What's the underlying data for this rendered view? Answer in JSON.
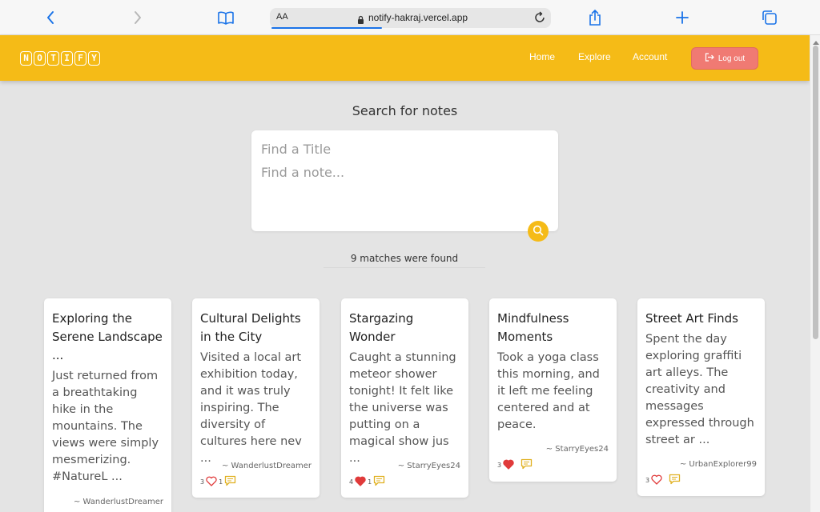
{
  "browser": {
    "text_size_label": "AA",
    "url": "notify-hakraj.vercel.app"
  },
  "header": {
    "logo_letters": [
      "N",
      "O",
      "T",
      "I",
      "F",
      "Y"
    ],
    "nav": {
      "home": "Home",
      "explore": "Explore",
      "account": "Account"
    },
    "logout_label": "Log out",
    "brand_color": "#f5bb17",
    "logout_color": "#f07a73"
  },
  "search": {
    "heading": "Search for notes",
    "title_placeholder": "Find a Title",
    "note_placeholder": "Find a note...",
    "results_text": "9 matches were found"
  },
  "notes": [
    {
      "title": "Exploring the Serene Landscape ...",
      "body": "Just returned from a breathtaking hike in the mountains. The views were simply mesmerizing. #NatureL ...",
      "author": "~ WanderlustDreamer",
      "likes": "",
      "comments": "",
      "liked": false
    },
    {
      "title": "Cultural Delights in the City",
      "body": "Visited a local art exhibition today, and it was truly inspiring. The diversity of cultures here nev ...",
      "author": "~ WanderlustDreamer",
      "likes": "3",
      "comments": "1",
      "liked": false
    },
    {
      "title": "Stargazing Wonder",
      "body": "Caught a stunning meteor shower tonight! It felt like the universe was putting on a magical show jus ...",
      "author": "~ StarryEyes24",
      "likes": "4",
      "comments": "1",
      "liked": true
    },
    {
      "title": "Mindfulness Moments",
      "body": "Took a yoga class this morning, and it left me feeling centered and at peace.",
      "author": "~ StarryEyes24",
      "likes": "3",
      "comments": "",
      "liked": true
    },
    {
      "title": "Street Art Finds",
      "body": "Spent the day exploring graffiti art alleys. The creativity and messages expressed through street ar ...",
      "author": "~ UrbanExplorer99",
      "likes": "3",
      "comments": "",
      "liked": false
    }
  ]
}
